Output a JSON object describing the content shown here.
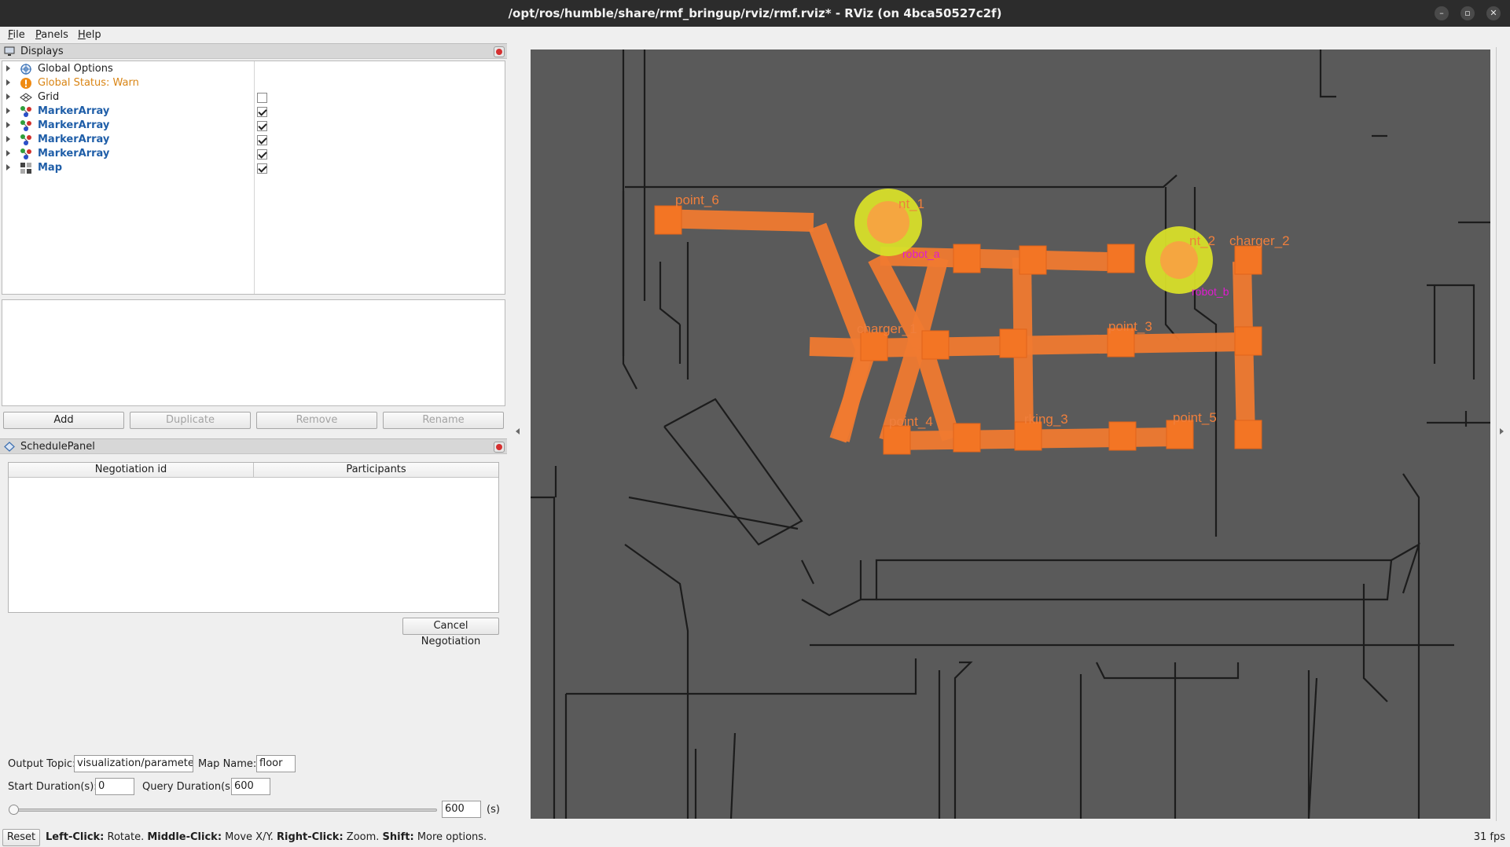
{
  "window": {
    "title": "/opt/ros/humble/share/rmf_bringup/rviz/rmf.rviz* - RViz (on 4bca50527c2f)",
    "controls": [
      "–",
      "▫",
      "✕"
    ]
  },
  "menubar": {
    "items": [
      {
        "first": "F",
        "rest": "ile"
      },
      {
        "first": "P",
        "rest": "anels"
      },
      {
        "first": "H",
        "rest": "elp"
      }
    ]
  },
  "displays_panel": {
    "title": "Displays",
    "items": [
      {
        "label": "Global Options",
        "icon": "globe-icon"
      },
      {
        "label": "Global Status: Warn",
        "icon": "warning-icon",
        "status": "warn"
      },
      {
        "label": "Grid",
        "icon": "grid-icon",
        "checked": false
      },
      {
        "label": "MarkerArray",
        "icon": "marker-array-icon",
        "checked": true
      },
      {
        "label": "MarkerArray",
        "icon": "marker-array-icon",
        "checked": true
      },
      {
        "label": "MarkerArray",
        "icon": "marker-array-icon",
        "checked": true
      },
      {
        "label": "MarkerArray",
        "icon": "marker-array-icon",
        "checked": true
      },
      {
        "label": "Map",
        "icon": "map-icon",
        "checked": true
      }
    ],
    "buttons": {
      "add": "Add",
      "duplicate": "Duplicate",
      "remove": "Remove",
      "rename": "Rename"
    }
  },
  "schedule_panel": {
    "title": "SchedulePanel",
    "columns": [
      "Negotiation id",
      "Participants"
    ],
    "cancel_button": "Cancel Negotiation",
    "output_topic_label": "Output Topic:",
    "output_topic_value": "visualization/parameters",
    "map_name_label": "Map Name:",
    "map_name_value": "floor",
    "start_duration_label": "Start Duration(s):",
    "start_duration_value": "0",
    "query_duration_label": "Query Duration(s):",
    "query_duration_value": "600",
    "slider_value": "600",
    "slider_unit": "(s)",
    "slider_position": 0.0
  },
  "status_bar": {
    "reset": "Reset",
    "hints": [
      {
        "key": "Left-Click:",
        "text": " Rotate. "
      },
      {
        "key": "Middle-Click:",
        "text": " Move X/Y. "
      },
      {
        "key": "Right-Click:",
        "text": " Zoom. "
      },
      {
        "key": "Shift:",
        "text": " More options."
      }
    ],
    "fps": "31 fps"
  },
  "viewport": {
    "waypoints": [
      "point_6",
      "nt_1",
      "nt_2",
      "charger_2",
      "charger_1",
      "point_3",
      "point_4",
      "rking_3",
      "point_5"
    ],
    "robots": [
      "robot_a",
      "robot_b"
    ],
    "colors": {
      "lane": "#f07a30",
      "node": "#f37524",
      "label": "#f07f3c",
      "robot_ring": "#d8df2a",
      "robot_core": "#f5a640",
      "robot_label": "#e01ad0",
      "floor": "#5a5a5a",
      "wall": "#1c1c1c"
    }
  }
}
